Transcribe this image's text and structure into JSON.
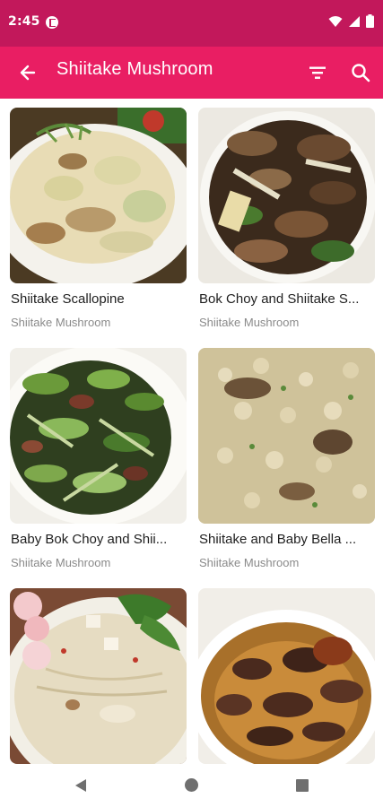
{
  "status_bar": {
    "time": "2:45",
    "app_icon": "notification-app-icon",
    "icons": [
      "wifi-icon",
      "signal-icon",
      "battery-icon"
    ]
  },
  "toolbar": {
    "title": "Shiitake Mushroom",
    "back_icon": "arrow-back-icon",
    "filter_icon": "filter-icon",
    "search_icon": "search-icon",
    "background_color": "#e91e63",
    "status_color": "#c2185b"
  },
  "recipes": [
    {
      "name": "Shiitake Scallopine",
      "category": "Shiitake Mushroom"
    },
    {
      "name": "Bok Choy and Shiitake S...",
      "category": "Shiitake Mushroom"
    },
    {
      "name": "Baby Bok Choy and Shii...",
      "category": "Shiitake Mushroom"
    },
    {
      "name": "Shiitake and Baby Bella ...",
      "category": "Shiitake Mushroom"
    },
    {
      "name": "",
      "category": ""
    },
    {
      "name": "",
      "category": ""
    }
  ],
  "nav_bar": {
    "back": "nav-back-icon",
    "home": "nav-home-icon",
    "recents": "nav-recents-icon"
  }
}
